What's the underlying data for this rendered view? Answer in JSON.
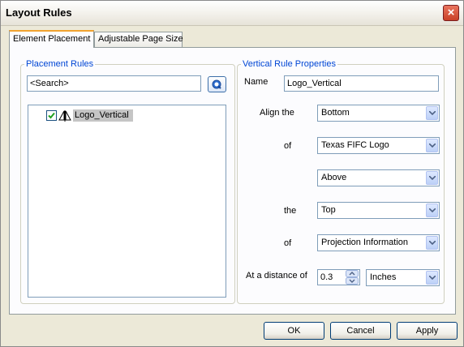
{
  "window": {
    "title": "Layout Rules"
  },
  "tabs": [
    {
      "label": "Element Placement",
      "active": true
    },
    {
      "label": "Adjustable Page Size",
      "active": false
    }
  ],
  "placement_rules": {
    "legend": "Placement Rules",
    "search_value": "<Search>",
    "items": [
      {
        "label": "Logo_Vertical",
        "checked": true,
        "icon": "vertical-rule-icon",
        "selected": true
      }
    ]
  },
  "vertical_rule": {
    "legend": "Vertical Rule Properties",
    "name_label": "Name",
    "name_value": "Logo_Vertical",
    "align_label": "Align the",
    "align_value": "Bottom",
    "of_label_1": "of",
    "of_value_1": "Texas FIFC Logo",
    "position_value": "Above",
    "the_label": "the",
    "the_value": "Top",
    "of_label_2": "of",
    "of_value_2": "Projection Information",
    "distance_label": "At a distance of",
    "distance_value": "0.3",
    "units_value": "Inches"
  },
  "buttons": {
    "ok": "OK",
    "cancel": "Cancel",
    "apply": "Apply"
  },
  "colors": {
    "accent": "#0046d5",
    "tab_highlight": "#f2a32f",
    "close": "#c94026"
  }
}
